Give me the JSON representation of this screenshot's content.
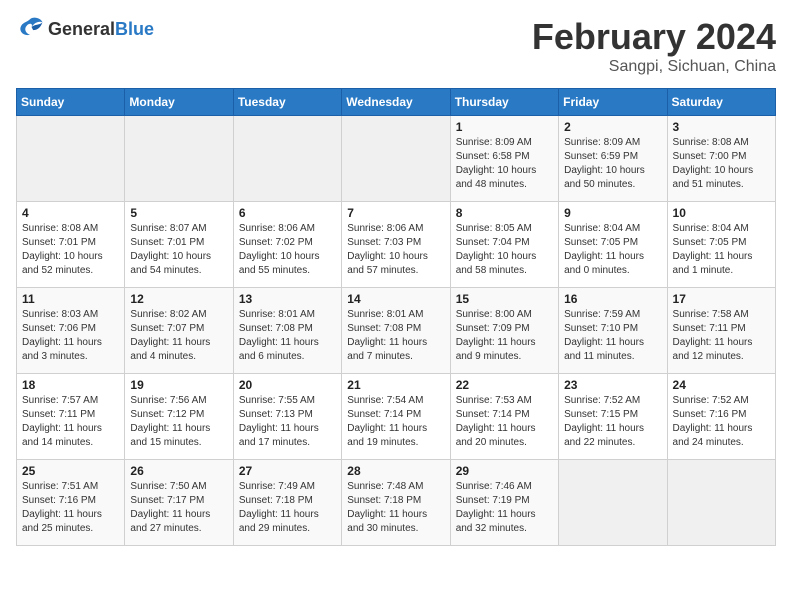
{
  "header": {
    "logo": {
      "text_general": "General",
      "text_blue": "Blue"
    },
    "title": "February 2024",
    "subtitle": "Sangpi, Sichuan, China"
  },
  "calendar": {
    "days_of_week": [
      "Sunday",
      "Monday",
      "Tuesday",
      "Wednesday",
      "Thursday",
      "Friday",
      "Saturday"
    ],
    "weeks": [
      [
        {
          "day": "",
          "info": ""
        },
        {
          "day": "",
          "info": ""
        },
        {
          "day": "",
          "info": ""
        },
        {
          "day": "",
          "info": ""
        },
        {
          "day": "1",
          "info": "Sunrise: 8:09 AM\nSunset: 6:58 PM\nDaylight: 10 hours\nand 48 minutes."
        },
        {
          "day": "2",
          "info": "Sunrise: 8:09 AM\nSunset: 6:59 PM\nDaylight: 10 hours\nand 50 minutes."
        },
        {
          "day": "3",
          "info": "Sunrise: 8:08 AM\nSunset: 7:00 PM\nDaylight: 10 hours\nand 51 minutes."
        }
      ],
      [
        {
          "day": "4",
          "info": "Sunrise: 8:08 AM\nSunset: 7:01 PM\nDaylight: 10 hours\nand 52 minutes."
        },
        {
          "day": "5",
          "info": "Sunrise: 8:07 AM\nSunset: 7:01 PM\nDaylight: 10 hours\nand 54 minutes."
        },
        {
          "day": "6",
          "info": "Sunrise: 8:06 AM\nSunset: 7:02 PM\nDaylight: 10 hours\nand 55 minutes."
        },
        {
          "day": "7",
          "info": "Sunrise: 8:06 AM\nSunset: 7:03 PM\nDaylight: 10 hours\nand 57 minutes."
        },
        {
          "day": "8",
          "info": "Sunrise: 8:05 AM\nSunset: 7:04 PM\nDaylight: 10 hours\nand 58 minutes."
        },
        {
          "day": "9",
          "info": "Sunrise: 8:04 AM\nSunset: 7:05 PM\nDaylight: 11 hours\nand 0 minutes."
        },
        {
          "day": "10",
          "info": "Sunrise: 8:04 AM\nSunset: 7:05 PM\nDaylight: 11 hours\nand 1 minute."
        }
      ],
      [
        {
          "day": "11",
          "info": "Sunrise: 8:03 AM\nSunset: 7:06 PM\nDaylight: 11 hours\nand 3 minutes."
        },
        {
          "day": "12",
          "info": "Sunrise: 8:02 AM\nSunset: 7:07 PM\nDaylight: 11 hours\nand 4 minutes."
        },
        {
          "day": "13",
          "info": "Sunrise: 8:01 AM\nSunset: 7:08 PM\nDaylight: 11 hours\nand 6 minutes."
        },
        {
          "day": "14",
          "info": "Sunrise: 8:01 AM\nSunset: 7:08 PM\nDaylight: 11 hours\nand 7 minutes."
        },
        {
          "day": "15",
          "info": "Sunrise: 8:00 AM\nSunset: 7:09 PM\nDaylight: 11 hours\nand 9 minutes."
        },
        {
          "day": "16",
          "info": "Sunrise: 7:59 AM\nSunset: 7:10 PM\nDaylight: 11 hours\nand 11 minutes."
        },
        {
          "day": "17",
          "info": "Sunrise: 7:58 AM\nSunset: 7:11 PM\nDaylight: 11 hours\nand 12 minutes."
        }
      ],
      [
        {
          "day": "18",
          "info": "Sunrise: 7:57 AM\nSunset: 7:11 PM\nDaylight: 11 hours\nand 14 minutes."
        },
        {
          "day": "19",
          "info": "Sunrise: 7:56 AM\nSunset: 7:12 PM\nDaylight: 11 hours\nand 15 minutes."
        },
        {
          "day": "20",
          "info": "Sunrise: 7:55 AM\nSunset: 7:13 PM\nDaylight: 11 hours\nand 17 minutes."
        },
        {
          "day": "21",
          "info": "Sunrise: 7:54 AM\nSunset: 7:14 PM\nDaylight: 11 hours\nand 19 minutes."
        },
        {
          "day": "22",
          "info": "Sunrise: 7:53 AM\nSunset: 7:14 PM\nDaylight: 11 hours\nand 20 minutes."
        },
        {
          "day": "23",
          "info": "Sunrise: 7:52 AM\nSunset: 7:15 PM\nDaylight: 11 hours\nand 22 minutes."
        },
        {
          "day": "24",
          "info": "Sunrise: 7:52 AM\nSunset: 7:16 PM\nDaylight: 11 hours\nand 24 minutes."
        }
      ],
      [
        {
          "day": "25",
          "info": "Sunrise: 7:51 AM\nSunset: 7:16 PM\nDaylight: 11 hours\nand 25 minutes."
        },
        {
          "day": "26",
          "info": "Sunrise: 7:50 AM\nSunset: 7:17 PM\nDaylight: 11 hours\nand 27 minutes."
        },
        {
          "day": "27",
          "info": "Sunrise: 7:49 AM\nSunset: 7:18 PM\nDaylight: 11 hours\nand 29 minutes."
        },
        {
          "day": "28",
          "info": "Sunrise: 7:48 AM\nSunset: 7:18 PM\nDaylight: 11 hours\nand 30 minutes."
        },
        {
          "day": "29",
          "info": "Sunrise: 7:46 AM\nSunset: 7:19 PM\nDaylight: 11 hours\nand 32 minutes."
        },
        {
          "day": "",
          "info": ""
        },
        {
          "day": "",
          "info": ""
        }
      ]
    ]
  }
}
